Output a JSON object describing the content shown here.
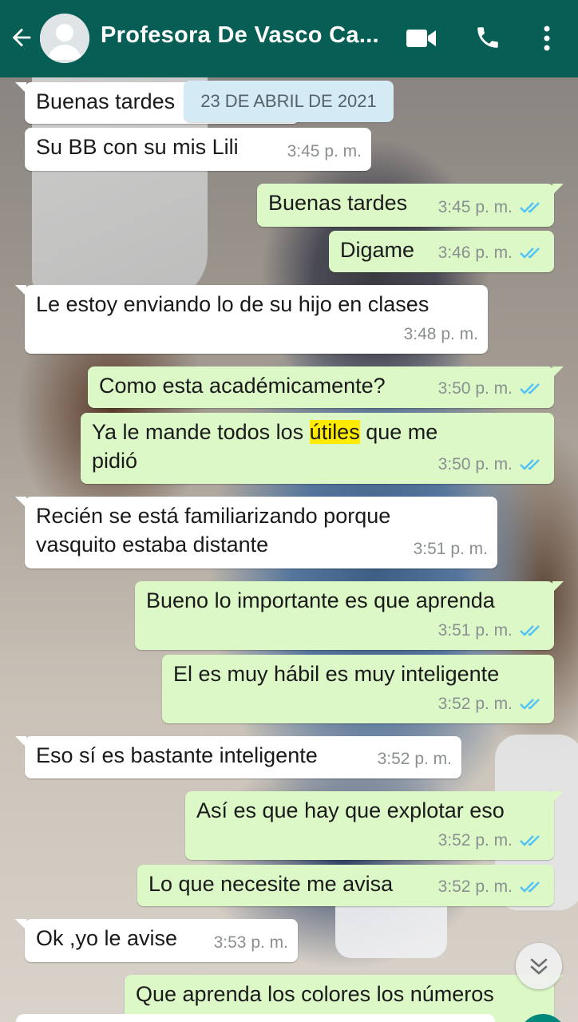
{
  "header": {
    "title": "Profesora De Vasco Ca...",
    "icons": [
      "back-arrow-icon",
      "avatar-icon",
      "video-call-icon",
      "phone-icon",
      "more-vert-icon"
    ]
  },
  "date_separator": "23 DE ABRIL DE 2021",
  "messages": [
    {
      "dir": "in",
      "text": "Buenas tardes",
      "time": ""
    },
    {
      "dir": "in",
      "text": "Su BB con su mis Lili",
      "time": "3:45 p. m."
    },
    {
      "dir": "out",
      "text": "Buenas tardes",
      "time": "3:45 p. m.",
      "read": true
    },
    {
      "dir": "out",
      "text": "Digame",
      "time": "3:46 p. m.",
      "read": true
    },
    {
      "dir": "in",
      "text": "Le estoy enviando lo de su hijo en clases",
      "time": "3:48 p. m."
    },
    {
      "dir": "out",
      "text": "Como esta académicamente?",
      "time": "3:50 p. m.",
      "read": true
    },
    {
      "dir": "out",
      "text_before": "Ya le mande todos los ",
      "text_highlight": "útiles",
      "text_after": " que me",
      "text_line2": "pidió",
      "time": "3:50 p. m.",
      "read": true
    },
    {
      "dir": "in",
      "text_line1": "Recién se está familiarizando porque",
      "text_line2": "vasquito estaba distante",
      "time": "3:51 p. m."
    },
    {
      "dir": "out",
      "text": "Bueno lo importante es que aprenda",
      "time": "3:51 p. m.",
      "read": true
    },
    {
      "dir": "out",
      "text": "El es muy hábil es muy inteligente",
      "time": "3:52 p. m.",
      "read": true
    },
    {
      "dir": "in",
      "text": "Eso sí es bastante inteligente",
      "time": "3:52 p. m."
    },
    {
      "dir": "out",
      "text": "Así es que hay que explotar eso",
      "time": "3:52 p. m.",
      "read": true
    },
    {
      "dir": "out",
      "text": "Lo que necesite me avisa",
      "time": "3:52 p. m.",
      "read": true
    },
    {
      "dir": "in",
      "text": "Ok ,yo le avise",
      "time": "3:53 p. m."
    },
    {
      "dir": "out",
      "text": "Que aprenda los colores los números",
      "time": ""
    }
  ],
  "colors": {
    "header": "#075e54",
    "incoming_bubble": "#ffffff",
    "outgoing_bubble": "#dcf8c6",
    "read_ticks": "#4fc3f7",
    "highlight": "#ffeb00",
    "date_pill": "#d4eaf4"
  }
}
